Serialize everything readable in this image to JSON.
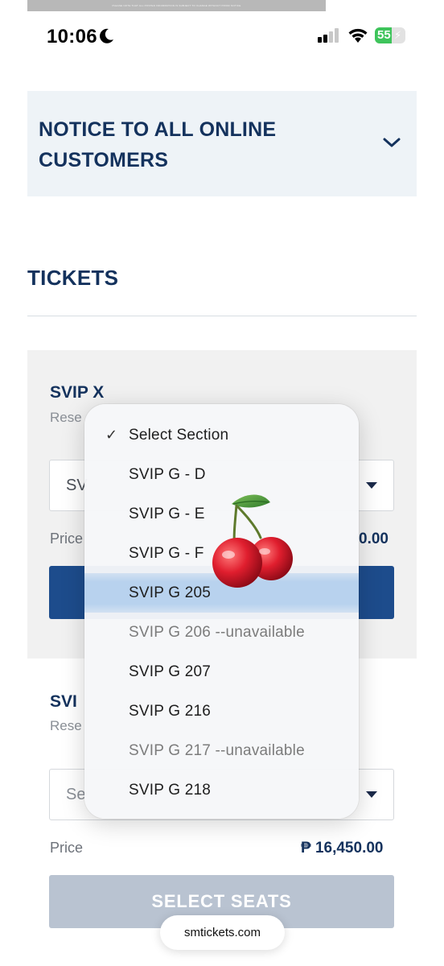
{
  "banner_text": "PLEASE NOTE THAT ALL POSTED INFORMATION IS SUBJECT TO CHANGE WITHOUT PRIOR NOTICE",
  "status": {
    "time": "10:06",
    "battery": "55",
    "battery_level": 0.55
  },
  "notice": {
    "title": "NOTICE TO ALL ONLINE CUSTOMERS"
  },
  "tickets_heading": "TICKETS",
  "tier1": {
    "name": "SVIP X",
    "subtitle": "Rese",
    "select_value": "SV",
    "price_label": "Price",
    "price_value": "0.00"
  },
  "tier2": {
    "name": "SVI",
    "subtitle": "Rese",
    "select_value": "Se",
    "price_label": "Price",
    "price_value": "₱ 16,450.00",
    "button_label": "SELECT SEATS"
  },
  "dropdown": {
    "selected_index": 4,
    "items": [
      {
        "label": "Select Section",
        "checked": true,
        "unavailable": false
      },
      {
        "label": "SVIP G - D",
        "checked": false,
        "unavailable": false
      },
      {
        "label": "SVIP G - E",
        "checked": false,
        "unavailable": false
      },
      {
        "label": "SVIP G - F",
        "checked": false,
        "unavailable": false
      },
      {
        "label": "SVIP G 205",
        "checked": false,
        "unavailable": false
      },
      {
        "label": "SVIP G 206 --unavailable",
        "checked": false,
        "unavailable": true
      },
      {
        "label": "SVIP G 207",
        "checked": false,
        "unavailable": false
      },
      {
        "label": "SVIP G 216",
        "checked": false,
        "unavailable": false
      },
      {
        "label": "SVIP G 217 --unavailable",
        "checked": false,
        "unavailable": true
      },
      {
        "label": "SVIP G 218",
        "checked": false,
        "unavailable": false
      }
    ]
  },
  "url": "smtickets.com",
  "colors": {
    "navy": "#14325d",
    "button_blue": "#1d4c8c",
    "highlight": "#b8d2ee",
    "battery_green": "#3ec45b"
  },
  "icons": [
    "moon-icon",
    "signal-icon",
    "wifi-icon",
    "battery-icon",
    "chevron-down-icon",
    "dropdown-caret-icon",
    "check-icon",
    "cherry-emoji"
  ]
}
